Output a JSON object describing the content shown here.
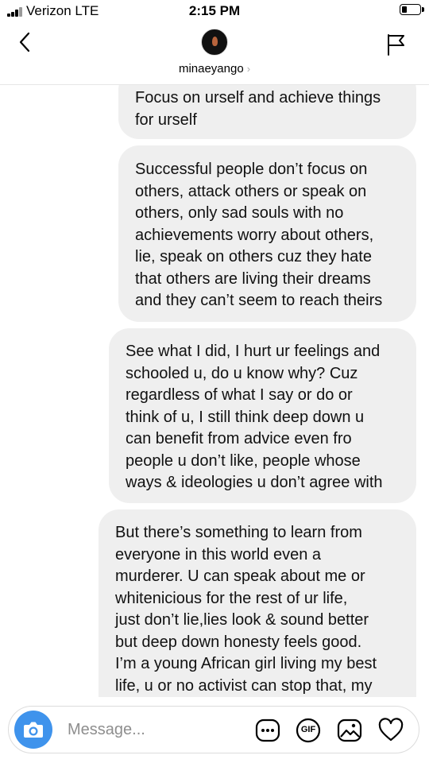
{
  "status_bar": {
    "carrier": "Verizon  LTE",
    "time": "2:15 PM"
  },
  "header": {
    "username": "minaeyango",
    "chevron": "›"
  },
  "messages": [
    {
      "lines": [
        "Focus on urself and achieve things",
        "for urself"
      ]
    },
    {
      "lines": [
        "Successful people don’t focus on",
        "others, attack others or speak on",
        "others, only sad souls with no",
        "achievements worry about others,",
        "lie, speak on others cuz they hate",
        "that others are living their dreams",
        "and they can’t seem to reach theirs"
      ]
    },
    {
      "lines": [
        "See what I did, I hurt ur feelings and",
        "schooled u, do u know why? Cuz",
        "regardless of what I say or do or",
        "think of u, I still think deep down u",
        "can benefit from advice even fro",
        "people u don’t like, people whose",
        "ways & ideologies u don’t agree with"
      ]
    },
    {
      "lines": [
        "But there’s something to learn from",
        "everyone in this world even a",
        "murderer. U can speak about me or",
        "whitenicious for the rest of ur life,",
        "just don’t lie,lies look & sound better",
        "but deep down honesty feels good.",
        "I’m a young African girl living my best",
        "life, u or no activist can stop that, my"
      ]
    }
  ],
  "composer": {
    "placeholder": "Message...",
    "gif_label": "GIF"
  },
  "icons": {
    "back": "back-arrow-icon",
    "flag": "flag-icon",
    "camera": "camera-icon",
    "sticker": "sticker-icon",
    "gif": "gif-icon",
    "gallery": "gallery-icon",
    "like": "heart-icon"
  },
  "colors": {
    "bubble": "#efefef",
    "camera": "#3f93ec",
    "placeholder": "#8e8e8e"
  }
}
